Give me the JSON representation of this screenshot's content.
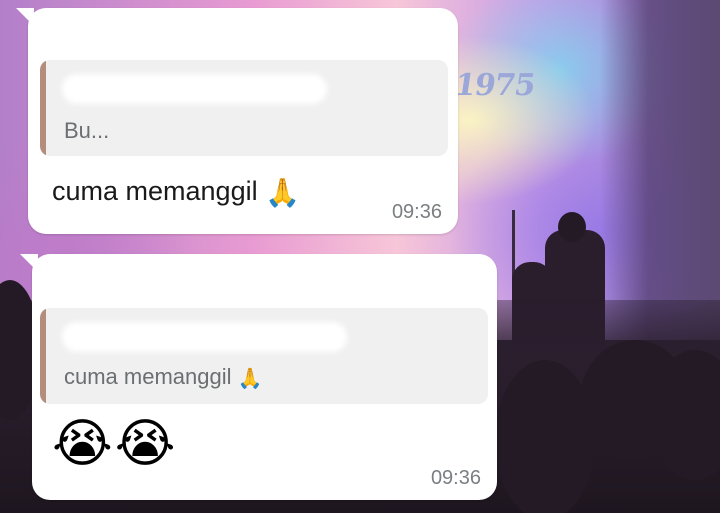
{
  "background": {
    "year_text": "1975",
    "accent_pink": "#e89bd2",
    "accent_purple": "#8f7bd4"
  },
  "messages": [
    {
      "quoted_text": "Bu...",
      "text": "cuma memanggil",
      "emoji": "🙏",
      "time": "09:36"
    },
    {
      "quoted_text": "cuma memanggil",
      "quoted_emoji": "🙏",
      "emojis": "😭😭",
      "time": "09:36"
    }
  ],
  "colors": {
    "bubble": "#ffffff",
    "quote_background": "#f0f0f0",
    "quote_bar": "#b58d7d",
    "timestamp": "#7a7f82"
  }
}
